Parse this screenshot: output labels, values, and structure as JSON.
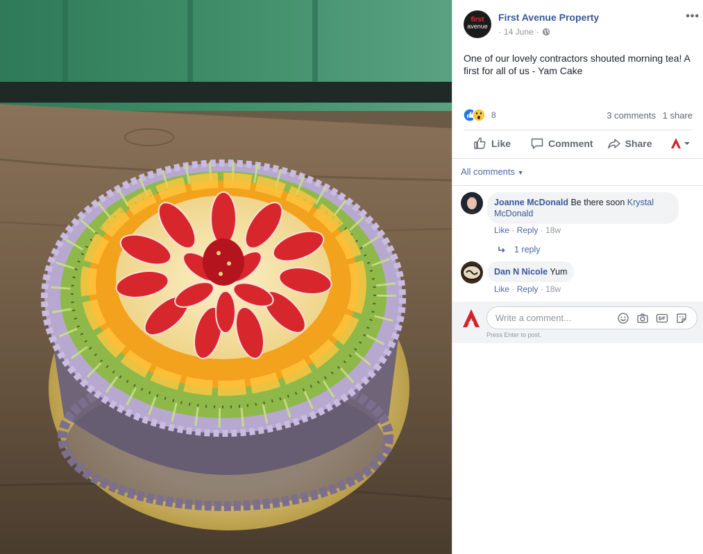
{
  "post": {
    "page_name": "First Avenue Property",
    "avatar_line1": "first",
    "avatar_line2": "avenue",
    "date": "14 June",
    "meta_separator": "·",
    "more_label": "•••",
    "text": "One of our lovely contractors shouted morning tea! A first for all of us - Yam Cake"
  },
  "reactions": {
    "count": "8",
    "comments": "3 comments",
    "shares": "1 share",
    "icons": [
      "like-reaction-icon",
      "wow-reaction-icon"
    ]
  },
  "actions": {
    "like": "Like",
    "comment": "Comment",
    "share": "Share"
  },
  "comments_filter": "All comments",
  "comments": [
    {
      "author": "Joanne McDonald",
      "text": "Be there soon",
      "mention": "Krystal McDonald",
      "like": "Like",
      "reply": "Reply",
      "time": "18w",
      "replies": "1 reply"
    },
    {
      "author": "Dan N Nicole",
      "text": "Yum",
      "like": "Like",
      "reply": "Reply",
      "time": "18w"
    }
  ],
  "composer": {
    "placeholder": "Write a comment...",
    "hint": "Press Enter to post."
  },
  "colors": {
    "link": "#385898",
    "muted": "#606770",
    "accent_red": "#e0322c"
  }
}
